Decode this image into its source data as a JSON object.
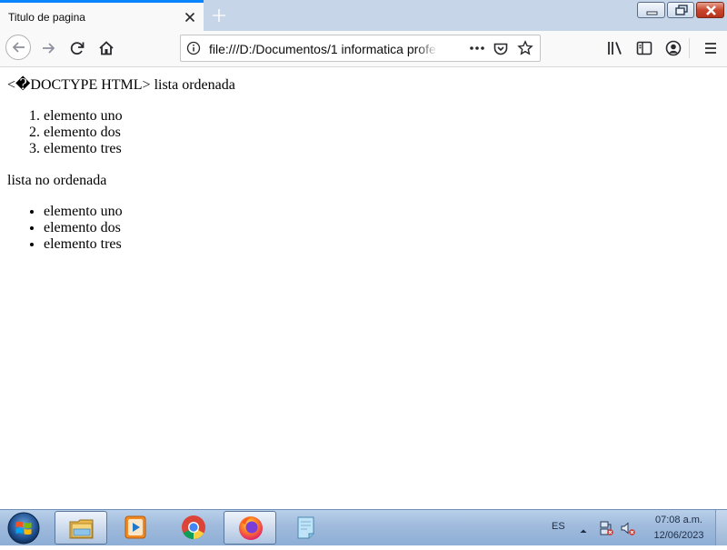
{
  "window": {
    "tab_title": "Titulo de pagina",
    "icons": [
      "tab-close-icon",
      "plus-icon",
      "minimize-icon",
      "maximize-icon",
      "close-icon"
    ]
  },
  "toolbar": {
    "url": "file:///D:/Documentos/1 informatica profe",
    "icons": [
      "back-arrow-icon",
      "forward-arrow-icon",
      "reload-icon",
      "home-icon",
      "info-icon",
      "more-dots-icon",
      "pocket-icon",
      "star-icon",
      "library-icon",
      "sidebar-icon",
      "account-icon",
      "hamburger-menu-icon"
    ]
  },
  "page": {
    "line1": "<�DOCTYPE HTML> lista ordenada",
    "ordered_list": [
      "elemento uno",
      "elemento dos",
      "elemento tres"
    ],
    "line2": "lista no ordenada",
    "unordered_list": [
      "elemento uno",
      "elemento dos",
      "elemento tres"
    ]
  },
  "taskbar": {
    "apps": [
      "windows-start-icon",
      "file-explorer-icon",
      "media-player-icon",
      "chrome-icon",
      "firefox-icon",
      "sticky-notes-icon"
    ],
    "language": "ES",
    "time": "07:08 a.m.",
    "date": "12/06/2023"
  },
  "colors": {
    "tab_accent": "#0a84ff",
    "titlebar_bg": "#c7d5e8",
    "toolbar_bg": "#f9f9fa",
    "taskbar_bg": "#9fbadc"
  }
}
